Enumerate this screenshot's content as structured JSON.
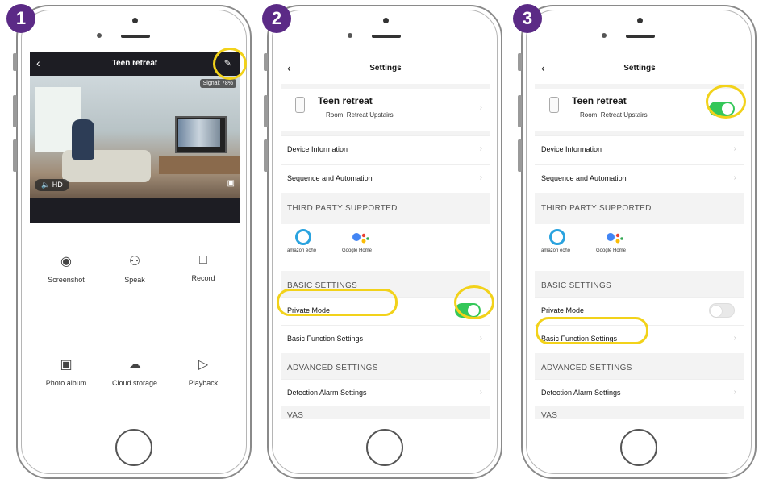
{
  "steps": [
    "1",
    "2",
    "3"
  ],
  "screen1": {
    "title": "Teen retreat",
    "signal": "Signal: 78%",
    "quality": "HD",
    "tools": [
      "Screenshot",
      "Speak",
      "Record",
      "Photo album",
      "Cloud storage",
      "Playback"
    ]
  },
  "settings": {
    "title": "Settings",
    "device_name": "Teen retreat",
    "room": "Room:  Retreat Upstairs",
    "device_info": "Device Information",
    "sequence": "Sequence and Automation",
    "third_party": "THIRD PARTY SUPPORTED",
    "alexa_label": "amazon echo",
    "google_label": "Google Home",
    "basic_settings": "BASIC SETTINGS",
    "private_mode": "Private Mode",
    "basic_function": "Basic Function Settings",
    "advanced_settings": "ADVANCED SETTINGS",
    "detection_alarm": "Detection Alarm Settings",
    "vas": "VAS"
  },
  "states": {
    "screen2_private_mode": "on",
    "screen3_private_mode": "off"
  },
  "colors": {
    "step_badge": "#5b2a86",
    "highlight": "#f2d21a",
    "toggle_on": "#34c759"
  }
}
